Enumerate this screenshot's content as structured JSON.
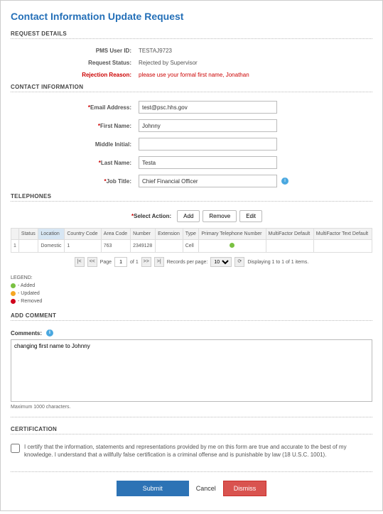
{
  "title": "Contact Information Update Request",
  "sections": {
    "request_details": "REQUEST DETAILS",
    "contact_info": "CONTACT INFORMATION",
    "telephones": "TELEPHONES",
    "add_comment": "ADD COMMENT",
    "certification": "CERTIFICATION"
  },
  "request": {
    "pms_user_id_label": "PMS User ID:",
    "pms_user_id": "TESTAJ9723",
    "status_label": "Request Status:",
    "status": "Rejected by Supervisor",
    "rejection_label": "Rejection Reason:",
    "rejection_reason": "please use your formal first name, Jonathan"
  },
  "contact": {
    "email_label": "Email Address:",
    "email": "test@psc.hhs.gov",
    "first_label": "First Name:",
    "first": "Johnny",
    "middle_label": "Middle Initial:",
    "middle": "",
    "last_label": "Last Name:",
    "last": "Testa",
    "title_label": "Job Title:",
    "title_val": "Chief Financial Officer"
  },
  "tel": {
    "select_action_label": "Select Action:",
    "add": "Add",
    "remove": "Remove",
    "edit": "Edit",
    "cols": {
      "status": "Status",
      "location": "Location",
      "cc": "Country Code",
      "area": "Area Code",
      "number": "Number",
      "ext": "Extension",
      "type": "Type",
      "primary": "Primary Telephone Number",
      "mfd": "MultiFactor Default",
      "mftd": "MultiFactor Text Default"
    },
    "row": {
      "idx": "1",
      "location": "Domestic",
      "cc": "1",
      "area": "763",
      "number": "2349128",
      "ext": "",
      "type": "Cell"
    },
    "pager": {
      "page": "Page",
      "of": "of 1",
      "rpp": "Records per page:",
      "rpp_val": "10",
      "display": "Displaying 1 to 1 of 1 items."
    }
  },
  "legend": {
    "title": "LEGEND:",
    "added": "- Added",
    "updated": "- Updated",
    "removed": "- Removed"
  },
  "comment": {
    "label": "Comments:",
    "value": "changing first name to Johnny",
    "max": "Maximum 1000 characters."
  },
  "cert": {
    "text": "I certify that the information, statements and representations provided by me on this form are true and accurate to the best of my knowledge. I understand that a willfully false certification is a criminal offense and is punishable by law (18 U.S.C. 1001)."
  },
  "actions": {
    "submit": "Submit",
    "cancel": "Cancel",
    "dismiss": "Dismiss"
  }
}
